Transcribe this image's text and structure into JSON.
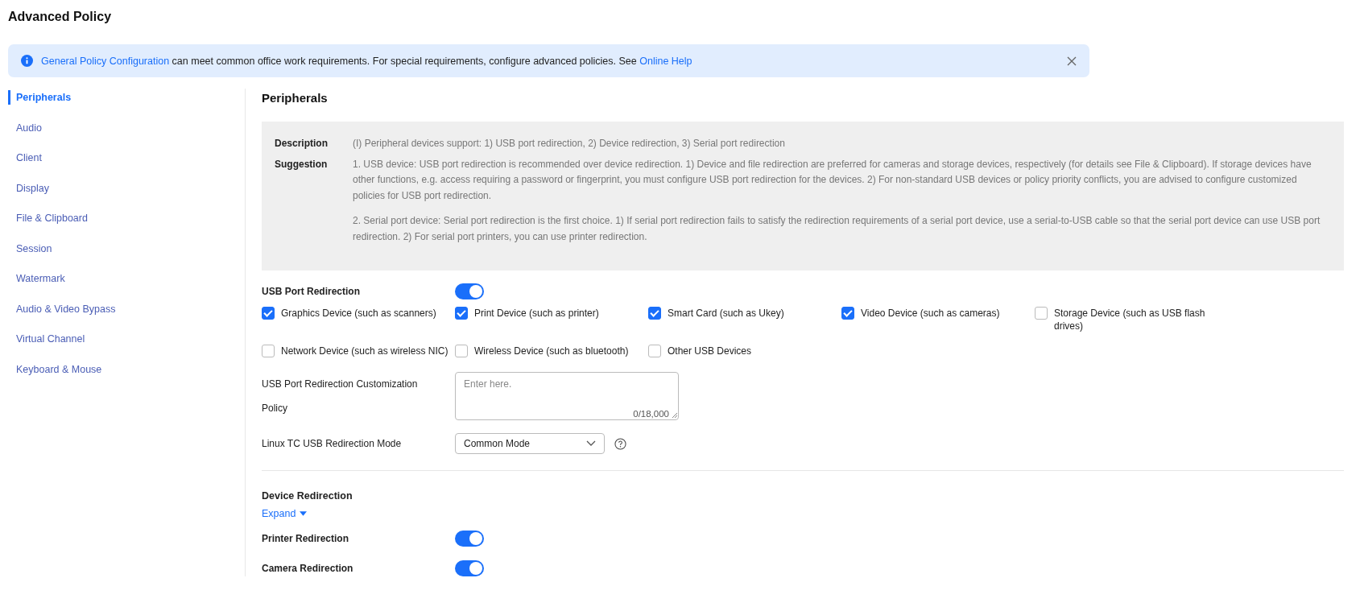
{
  "page_title": "Advanced Policy",
  "banner": {
    "parts": [
      {
        "kind": "link",
        "text": "General Policy Configuration"
      },
      {
        "kind": "text",
        "text": " can meet common office work requirements. For special requirements, configure advanced policies. See "
      },
      {
        "kind": "link",
        "text": "Online Help"
      }
    ]
  },
  "sidebar": {
    "items": [
      {
        "label": "Peripherals",
        "selected": true
      },
      {
        "label": "Audio",
        "selected": false
      },
      {
        "label": "Client",
        "selected": false
      },
      {
        "label": "Display",
        "selected": false
      },
      {
        "label": "File & Clipboard",
        "selected": false
      },
      {
        "label": "Session",
        "selected": false
      },
      {
        "label": "Watermark",
        "selected": false
      },
      {
        "label": "Audio & Video Bypass",
        "selected": false
      },
      {
        "label": "Virtual Channel",
        "selected": false
      },
      {
        "label": "Keyboard & Mouse",
        "selected": false
      }
    ]
  },
  "section_title": "Peripherals",
  "info": {
    "rows": [
      {
        "label": "Description",
        "paragraphs": [
          "(I) Peripheral devices support: 1) USB port redirection, 2) Device redirection, 3) Serial port redirection"
        ]
      },
      {
        "label": "Suggestion",
        "paragraphs": [
          "1. USB device: USB port redirection is recommended over device redirection. 1) Device and file redirection are preferred for cameras and storage devices, respectively (for details see File & Clipboard). If storage devices have other functions, e.g. access requiring a password or fingerprint, you must configure USB port redirection for the devices. 2) For non-standard USB devices or policy priority conflicts, you are advised to configure customized policies for USB port redirection.",
          "2. Serial port device: Serial port redirection is the first choice. 1) If serial port redirection fails to satisfy the redirection requirements of a serial port device, use a serial-to-USB cable so that the serial port device can use USB port redirection. 2) For serial port printers, you can use printer redirection."
        ]
      }
    ]
  },
  "usb": {
    "label": "USB Port Redirection",
    "on": true,
    "devices": [
      {
        "label": "Graphics Device (such as scanners)",
        "checked": true
      },
      {
        "label": "Print Device (such as printer)",
        "checked": true
      },
      {
        "label": "Smart Card (such as Ukey)",
        "checked": true
      },
      {
        "label": "Video Device (such as cameras)",
        "checked": true
      },
      {
        "label": "Storage Device (such as USB flash drives)",
        "checked": false
      },
      {
        "label": "Network Device (such as wireless NIC)",
        "checked": false
      },
      {
        "label": "Wireless Device (such as bluetooth)",
        "checked": false
      },
      {
        "label": "Other USB Devices",
        "checked": false
      }
    ],
    "policy": {
      "label": "USB Port Redirection Customization Policy",
      "placeholder": "Enter here.",
      "counter": "0/18,000"
    },
    "mode": {
      "label": "Linux TC USB Redirection Mode",
      "value": "Common Mode"
    }
  },
  "device_redirection": {
    "title": "Device Redirection",
    "expand": "Expand",
    "toggles": [
      {
        "label": "Printer Redirection",
        "on": true
      },
      {
        "label": "Camera Redirection",
        "on": true
      }
    ]
  }
}
